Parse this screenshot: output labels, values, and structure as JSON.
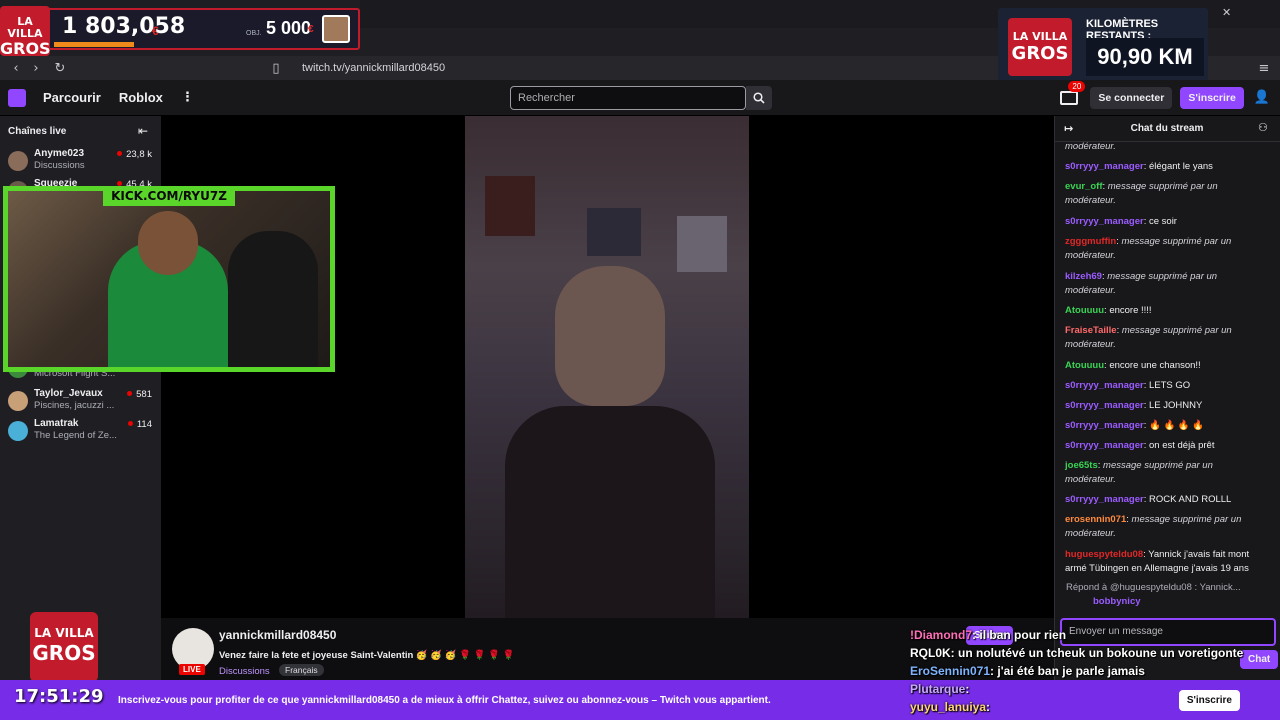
{
  "browser": {
    "url": "twitch.tv/yannickmillard08450"
  },
  "overlay": {
    "counter_value": "1 803,058",
    "counter_suffix": "€",
    "goal_label": "OBJ.",
    "goal_value": "5 000",
    "goal_suffix": "€",
    "logo_line1": "LA VILLA",
    "logo_line2": "GROS",
    "km_title": "KILOMÈTRES RESTANTS :",
    "km_value": "90,90 KM",
    "kick_banner": "KICK.COM/RYU7Z",
    "clock": "17:51:29",
    "chat_overlay": [
      {
        "user": "!Diamond7",
        "text": "il ban pour rien",
        "color": "#ff6fb8"
      },
      {
        "user": "RQL0K",
        "text": "un nolutévé un tcheuk un bokoune un voretigonte",
        "color": "#ffffff"
      },
      {
        "user": "EroSennin071",
        "text": "j'ai été ban je parle jamais",
        "color": "#7fb4ff"
      },
      {
        "user": "Plutarque",
        "text": "",
        "color": "#c9a8ff"
      },
      {
        "user": "yuyu_lanuiya",
        "text": "",
        "color": "#ffd37a"
      }
    ]
  },
  "nav": {
    "browse": "Parcourir",
    "roblox": "Roblox",
    "search_placeholder": "Rechercher",
    "notif_count": "20",
    "login": "Se connecter",
    "signup": "S'inscrire"
  },
  "sidebar": {
    "title": "Chaînes live",
    "channels": [
      {
        "name": "Anyme023",
        "game": "Discussions",
        "viewers": "23,8 k",
        "color": "#8a6c5a"
      },
      {
        "name": "Squeezie",
        "game": "",
        "viewers": "45,4 k",
        "color": "#6a5a4a"
      },
      {
        "name": "",
        "game": "Microsoft Flight S...",
        "viewers": "",
        "color": "#3c8a3c"
      },
      {
        "name": "Taylor_Jevaux",
        "game": "Piscines, jacuzzi ...",
        "viewers": "581",
        "color": "#c8a078"
      },
      {
        "name": "Lamatrak",
        "game": "The Legend of Ze...",
        "viewers": "114",
        "color": "#4ab0d8"
      }
    ]
  },
  "stream": {
    "channel": "yannickmillard08450",
    "title": "Venez faire la fete et joyeuse Saint-Valentin 🥳 🥳 🥳 🌹 🌹 🌹 🌹",
    "category": "Discussions",
    "tag": "Français",
    "live": "LIVE",
    "follow": "Suivre"
  },
  "chat": {
    "header": "Chat du stream",
    "messages": [
      {
        "user": "",
        "text": "modérateur.",
        "italic": true,
        "color": "#efeff1"
      },
      {
        "user": "s0rryyy_manager",
        "text": "élégant le yans",
        "italic": false,
        "color": "#9b5cff"
      },
      {
        "user": "evur_off",
        "text": "message supprimé par un modérateur.",
        "italic": true,
        "color": "#39d353"
      },
      {
        "user": "s0rryyy_manager",
        "text": "ce soir",
        "italic": false,
        "color": "#9b5cff"
      },
      {
        "user": "zgggmuffin",
        "text": "message supprimé par un modérateur.",
        "italic": true,
        "color": "#e02828"
      },
      {
        "user": "kilzeh69",
        "text": "message supprimé par un modérateur.",
        "italic": true,
        "color": "#9b5cff"
      },
      {
        "user": "Atouuuu",
        "text": "encore !!!!",
        "italic": false,
        "color": "#39d353"
      },
      {
        "user": "FraiseTaille",
        "text": "message supprimé par un modérateur.",
        "italic": true,
        "color": "#ff6a6a"
      },
      {
        "user": "Atouuuu",
        "text": "encore une chanson!!",
        "italic": false,
        "color": "#39d353"
      },
      {
        "user": "s0rryyy_manager",
        "text": "LETS GO",
        "italic": false,
        "color": "#9b5cff"
      },
      {
        "user": "s0rryyy_manager",
        "text": "LE JOHNNY",
        "italic": false,
        "color": "#9b5cff"
      },
      {
        "user": "s0rryyy_manager",
        "text": "🔥 🔥 🔥 🔥",
        "italic": false,
        "color": "#9b5cff"
      },
      {
        "user": "s0rryyy_manager",
        "text": "on est déjà prêt",
        "italic": false,
        "color": "#9b5cff"
      },
      {
        "user": "joe65ts",
        "text": "message supprimé par un modérateur.",
        "italic": true,
        "color": "#39d353"
      },
      {
        "user": "s0rryyy_manager",
        "text": "ROCK AND ROLLL",
        "italic": false,
        "color": "#9b5cff"
      },
      {
        "user": "erosennin071",
        "text": "message supprimé par un modérateur.",
        "italic": true,
        "color": "#ff8a3d"
      },
      {
        "user": "huguespyteldu08",
        "text": "Yannick j'avais fait mont armé Tübingen en Allemagne j'avais 19 ans",
        "italic": false,
        "color": "#e02828"
      }
    ],
    "reply_label": "Répond à @huguespyteldu08 : Yannick...",
    "reply_user": "bobbynicy",
    "input_placeholder": "Envoyer un message",
    "send": "Chat"
  },
  "banner": {
    "text": "Inscrivez-vous pour profiter de ce que yannickmillard08450 a de mieux à offrir Chattez, suivez ou abonnez-vous – Twitch vous appartient.",
    "button": "S'inscrire"
  }
}
